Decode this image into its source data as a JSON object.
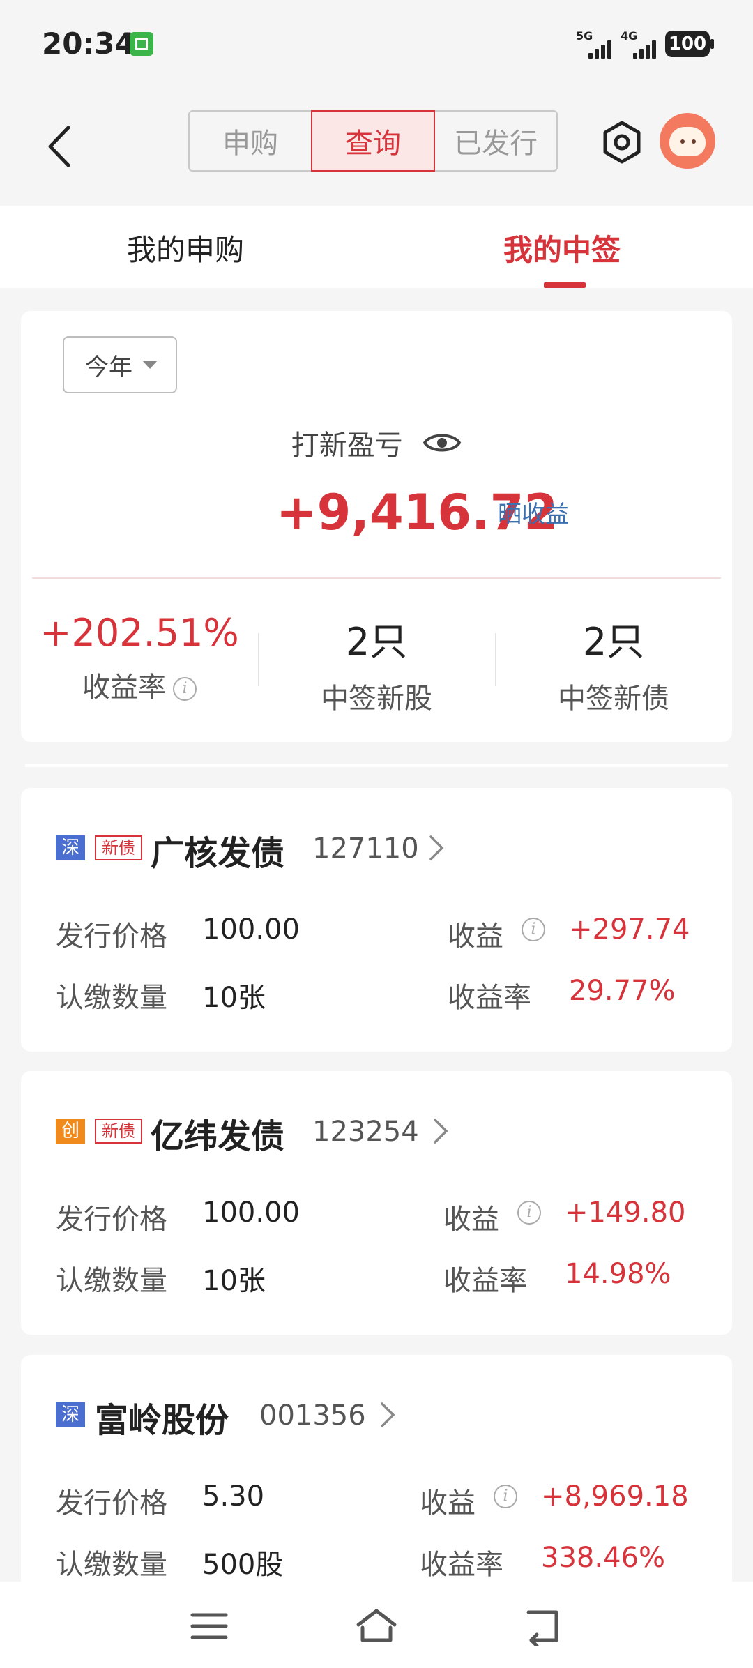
{
  "status_bar": {
    "time": "20:34",
    "net1": "5G",
    "net2": "4G",
    "battery": "100"
  },
  "header": {
    "segments": [
      {
        "label": "申购",
        "active": false
      },
      {
        "label": "查询",
        "active": true
      },
      {
        "label": "已发行",
        "active": false
      }
    ],
    "icons": [
      "back-icon",
      "settings-icon",
      "avatar"
    ]
  },
  "subtabs": {
    "left": "我的申购",
    "right": "我的中签",
    "active": "right"
  },
  "summary": {
    "period": "今年",
    "pl_label": "打新盈亏",
    "pl_value": "+9,416.72",
    "share_label": "晒收益",
    "stats": [
      {
        "value": "+202.51%",
        "label": "收益率"
      },
      {
        "value": "2只",
        "label": "中签新股"
      },
      {
        "value": "2只",
        "label": "中签新债"
      }
    ]
  },
  "labels": {
    "issue_price": "发行价格",
    "quantity": "认缴数量",
    "profit": "收益",
    "profit_rate": "收益率"
  },
  "holdings": [
    {
      "market": "深",
      "tag": "新债",
      "name": "广核发债",
      "code": "127110",
      "issue_price": "100.00",
      "quantity": "10张",
      "profit": "+297.74",
      "profit_rate": "29.77%"
    },
    {
      "market": "创",
      "tag": "新债",
      "name": "亿纬发债",
      "code": "123254",
      "issue_price": "100.00",
      "quantity": "10张",
      "profit": "+149.80",
      "profit_rate": "14.98%"
    },
    {
      "market": "深",
      "tag": "",
      "name": "富岭股份",
      "code": "001356",
      "issue_price": "5.30",
      "quantity": "500股",
      "profit": "+8,969.18",
      "profit_rate": "338.46%"
    }
  ],
  "colors": {
    "accent": "#d6333b",
    "link": "#3a6fb0",
    "badge_sz": "#4a6fd0",
    "badge_cy": "#f08a1c"
  }
}
